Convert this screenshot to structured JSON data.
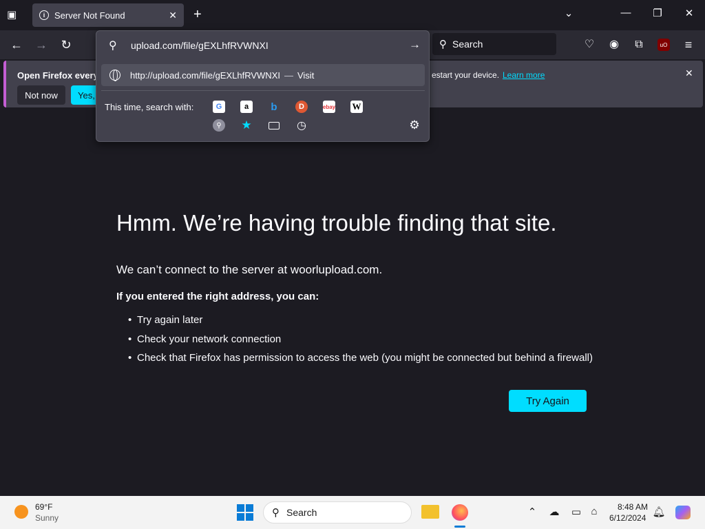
{
  "tabs": [
    {
      "title": "Server Not Found"
    }
  ],
  "toolbar": {
    "address_text": "upload.com/file/gEXLhfRVWNXI",
    "search_placeholder": "Search"
  },
  "url_dropdown": {
    "suggestion_url": "http://upload.com/file/gEXLhfRVWNXI",
    "suggestion_dash": "—",
    "suggestion_action": "Visit",
    "search_with_label": "This time, search with:",
    "engines": [
      "Google",
      "Amazon",
      "Bing",
      "DuckDuckGo",
      "eBay",
      "Wikipedia"
    ],
    "extra_icons": [
      "search-shortcut",
      "bookmarks",
      "tabs",
      "history",
      "settings"
    ]
  },
  "notification": {
    "title": "Open Firefox every ti",
    "tail": "estart your device.",
    "link": "Learn more",
    "not_now": "Not now",
    "yes": "Yes, c"
  },
  "error": {
    "title": "Hmm. We’re having trouble finding that site.",
    "description": "We can’t connect to the server at woorlupload.com.",
    "subtitle": "If you entered the right address, you can:",
    "items": [
      "Try again later",
      "Check your network connection",
      "Check that Firefox has permission to access the web (you might be connected but behind a firewall)"
    ],
    "button": "Try Again"
  },
  "taskbar": {
    "weather_temp": "69°F",
    "weather_cond": "Sunny",
    "search_label": "Search",
    "time": "8:48 AM",
    "date": "6/12/2024"
  },
  "colors": {
    "accent": "#00ddff",
    "background": "#1c1b22",
    "panel": "#42414d"
  }
}
